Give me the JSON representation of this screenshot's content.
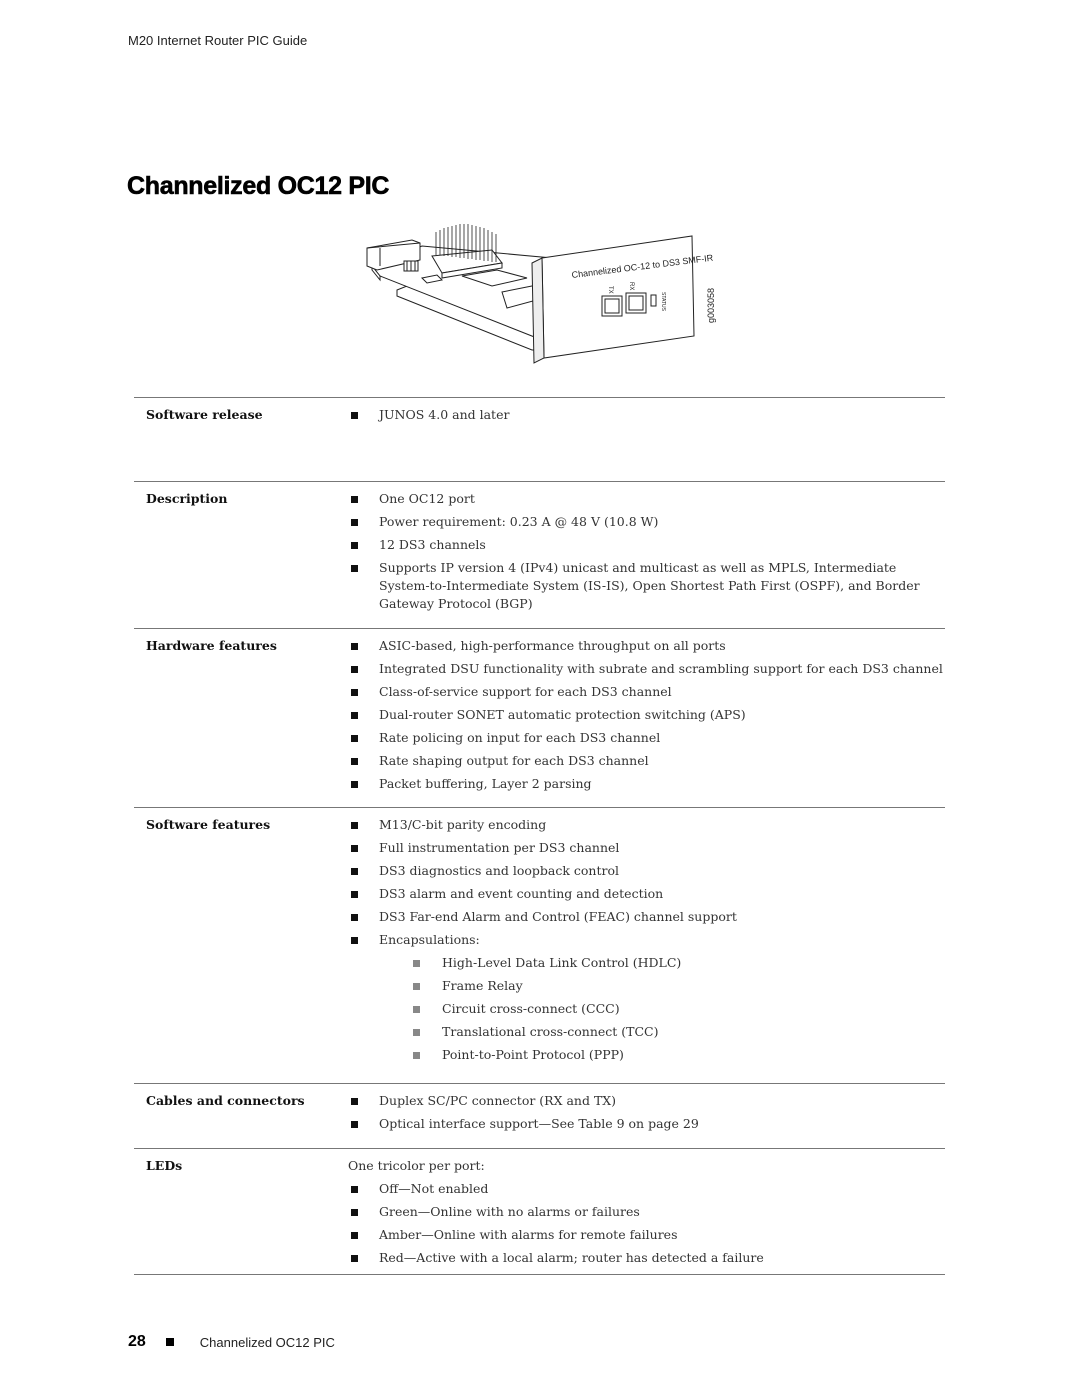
{
  "header": {
    "running_title": "M20 Internet Router PIC Guide"
  },
  "page": {
    "title": "Channelized OC12 PIC"
  },
  "figure": {
    "faceplate_label": "Channelized OC-12 to DS3 SMF-IR",
    "port_labels": [
      "TX",
      "RX"
    ],
    "led_label": "STATUS",
    "figure_id": "g003058"
  },
  "specs": {
    "software_release": {
      "label": "Software release",
      "items": [
        "JUNOS 4.0 and later"
      ]
    },
    "description": {
      "label": "Description",
      "items": [
        "One OC12 port",
        "Power requirement: 0.23 A @ 48 V (10.8 W)",
        "12 DS3 channels",
        "Supports IP version 4 (IPv4) unicast and multicast as well as MPLS, Intermediate System-to-Intermediate System (IS-IS), Open Shortest Path First (OSPF), and Border Gateway Protocol (BGP)"
      ]
    },
    "hardware_features": {
      "label": "Hardware features",
      "items": [
        "ASIC-based, high-performance throughput on all ports",
        "Integrated DSU functionality with subrate and scrambling support for each DS3 channel",
        "Class-of-service support for each DS3 channel",
        "Dual-router SONET automatic protection switching (APS)",
        "Rate policing on input for each DS3 channel",
        "Rate shaping output for each DS3 channel",
        "Packet buffering, Layer 2 parsing"
      ]
    },
    "software_features": {
      "label": "Software features",
      "items": [
        "M13/C-bit parity encoding",
        "Full instrumentation per DS3 channel",
        "DS3 diagnostics and loopback control",
        "DS3 alarm and event counting and detection",
        "DS3 Far-end Alarm and Control (FEAC) channel support",
        "Encapsulations:"
      ],
      "encapsulations": [
        "High-Level Data Link Control (HDLC)",
        "Frame Relay",
        "Circuit cross-connect (CCC)",
        "Translational cross-connect (TCC)",
        "Point-to-Point Protocol (PPP)"
      ]
    },
    "cables_connectors": {
      "label": "Cables and connectors",
      "items": [
        "Duplex SC/PC connector (RX and TX)",
        "Optical interface support—See Table 9 on page 29"
      ]
    },
    "leds": {
      "label": "LEDs",
      "lead": "One tricolor per port:",
      "items": [
        "Off—Not enabled",
        "Green—Online with no alarms or failures",
        "Amber—Online with alarms for remote failures",
        "Red—Active with a local alarm; router has detected a failure"
      ]
    }
  },
  "footer": {
    "page_number": "28",
    "title": "Channelized OC12 PIC"
  }
}
